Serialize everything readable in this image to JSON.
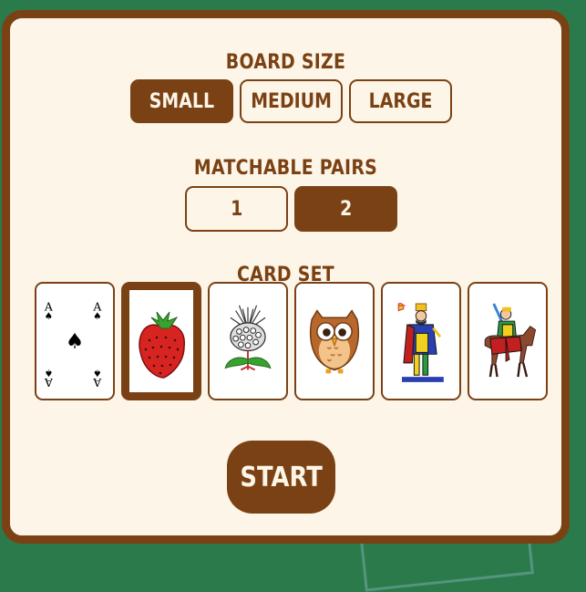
{
  "board_size": {
    "title": "BOARD SIZE",
    "options": [
      {
        "label": "SMALL",
        "selected": true
      },
      {
        "label": "MEDIUM",
        "selected": false
      },
      {
        "label": "LARGE",
        "selected": false
      }
    ]
  },
  "matchable_pairs": {
    "title": "MATCHABLE PAIRS",
    "options": [
      {
        "label": "1",
        "selected": false
      },
      {
        "label": "2",
        "selected": true
      }
    ]
  },
  "card_set": {
    "title": "CARD SET",
    "cards": [
      {
        "icon": "ace-of-spades-icon",
        "selected": false,
        "rank": "A",
        "suit": "♠"
      },
      {
        "icon": "strawberry-icon",
        "selected": true
      },
      {
        "icon": "thistle-icon",
        "selected": false
      },
      {
        "icon": "owl-icon",
        "selected": false
      },
      {
        "icon": "king-of-cups-icon",
        "selected": false
      },
      {
        "icon": "knight-on-horse-icon",
        "selected": false
      }
    ]
  },
  "start_label": "START",
  "colors": {
    "accent": "#7a4214",
    "panel_bg": "#fdf5e8",
    "table_bg": "#2b7a4b"
  }
}
